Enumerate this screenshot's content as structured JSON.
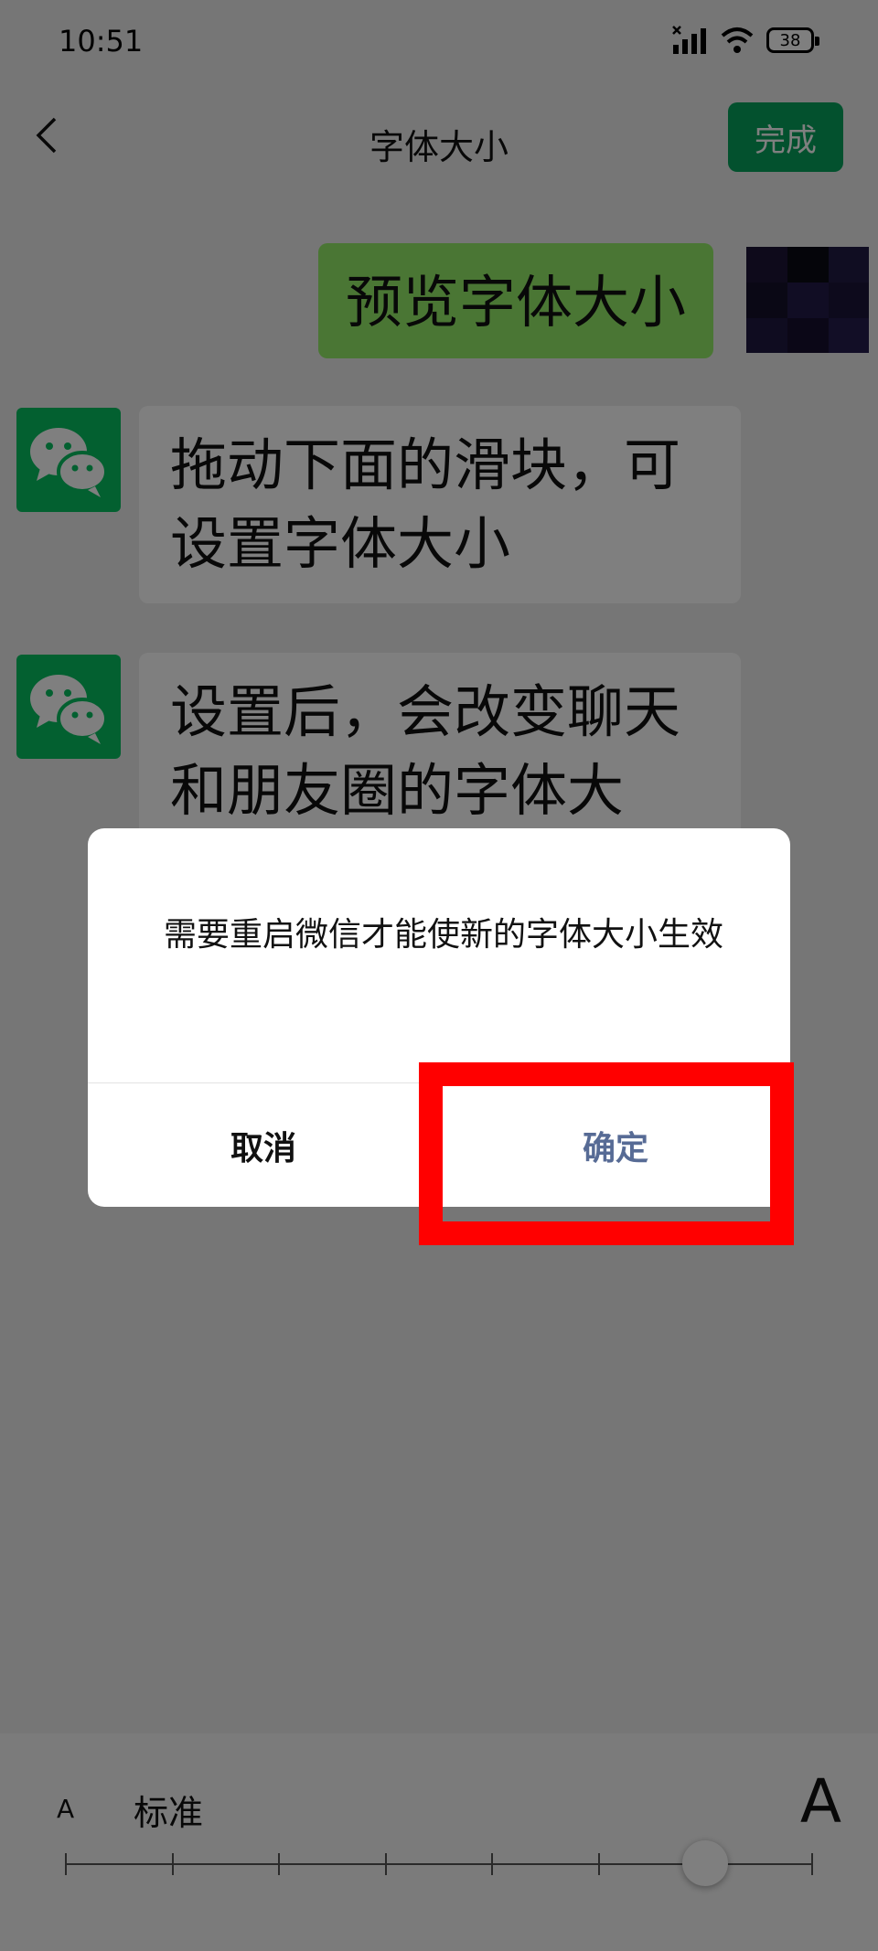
{
  "status_bar": {
    "time": "10:51",
    "battery": "38"
  },
  "header": {
    "title": "字体大小",
    "done_label": "完成"
  },
  "chat": {
    "my_message": "预览字体大小",
    "messages": [
      "拖动下面的滑块，可设置字体大小",
      "设置后，会改变聊天和朋友圈的字体大小。"
    ]
  },
  "font_slider": {
    "small_label": "A",
    "current_level_label": "标准",
    "large_label": "A",
    "levels": 8,
    "selected_level": 6
  },
  "dialog": {
    "message": "需要重启微信才能使新的字体大小生效",
    "cancel_label": "取消",
    "confirm_label": "确定"
  },
  "colors": {
    "wechat_green": "#07c160",
    "bubble_green": "#95ec69",
    "confirm_text": "#576b95",
    "highlight_red": "#ff0000"
  }
}
